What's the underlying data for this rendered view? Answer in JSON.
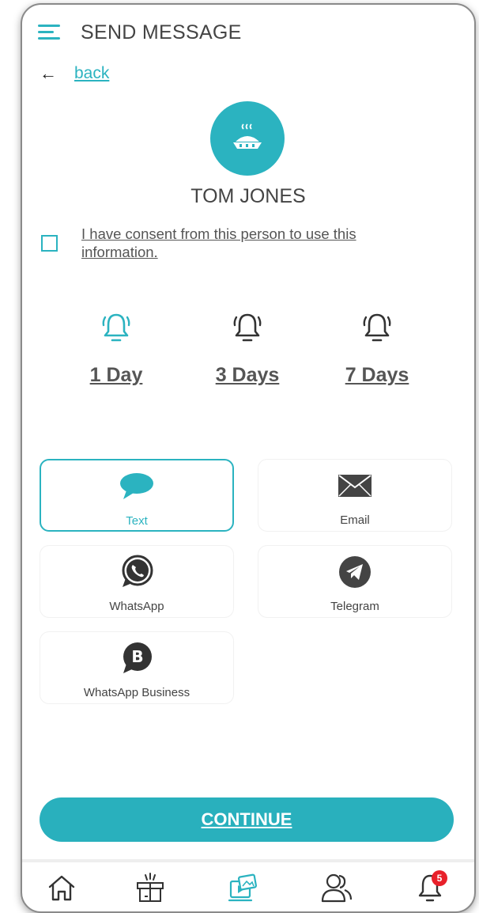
{
  "header": {
    "title": "SEND MESSAGE",
    "menu_icon": "hamburger-icon"
  },
  "back": {
    "label": "back",
    "icon": "arrow-left-icon"
  },
  "contact": {
    "name": "TOM JONES",
    "avatar_icon": "pie-icon"
  },
  "consent": {
    "label": "I have consent from this person to use this information.",
    "checked": false
  },
  "reminders": [
    {
      "label": "1 Day",
      "selected": true
    },
    {
      "label": "3 Days",
      "selected": false
    },
    {
      "label": "7 Days",
      "selected": false
    }
  ],
  "channels": [
    {
      "label": "Text",
      "icon": "speech-bubble-icon",
      "selected": true
    },
    {
      "label": "Email",
      "icon": "envelope-icon",
      "selected": false
    },
    {
      "label": "WhatsApp",
      "icon": "whatsapp-icon",
      "selected": false
    },
    {
      "label": "Telegram",
      "icon": "telegram-icon",
      "selected": false
    },
    {
      "label": "WhatsApp Business",
      "icon": "whatsapp-business-icon",
      "selected": false
    }
  ],
  "continue_label": "CONTINUE",
  "nav": {
    "items": [
      {
        "name": "home",
        "icon": "home-icon"
      },
      {
        "name": "gift",
        "icon": "gift-icon"
      },
      {
        "name": "media",
        "icon": "media-icon",
        "active": true
      },
      {
        "name": "contacts",
        "icon": "people-icon"
      },
      {
        "name": "notifications",
        "icon": "bell-icon"
      }
    ],
    "notification_count": "5"
  },
  "colors": {
    "accent": "#2bb3c0",
    "badge": "#e8202a",
    "text": "#444444"
  }
}
